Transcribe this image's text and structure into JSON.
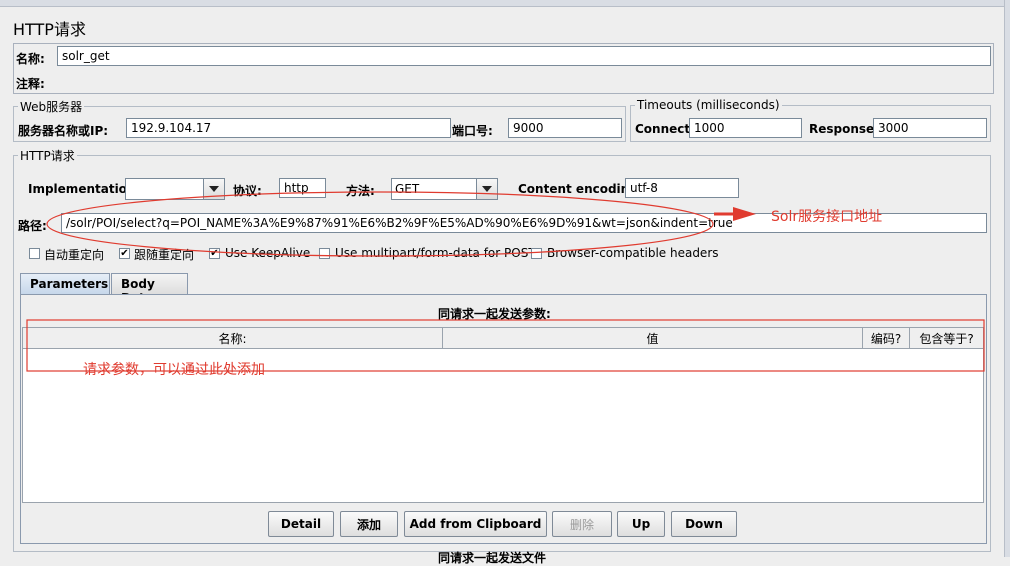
{
  "window": {
    "title": "HTTP请求"
  },
  "basic": {
    "name_label": "名称:",
    "name_value": "solr_get",
    "comment_label": "注释:"
  },
  "web_server": {
    "legend": "Web服务器",
    "server_label": "服务器名称或IP:",
    "server_value": "192.9.104.17",
    "port_label": "端口号:",
    "port_value": "9000"
  },
  "timeouts": {
    "legend": "Timeouts (milliseconds)",
    "connect_label": "Connect:",
    "connect_value": "1000",
    "response_label": "Response:",
    "response_value": "3000"
  },
  "http_request": {
    "legend": "HTTP请求",
    "implementation_label": "Implementation:",
    "implementation_value": "",
    "protocol_label": "协议:",
    "protocol_value": "http",
    "method_label": "方法:",
    "method_value": "GET",
    "encoding_label": "Content encoding:",
    "encoding_value": "utf-8",
    "path_label": "路径:",
    "path_value": "/solr/POI/select?q=POI_NAME%3A%E9%87%91%E6%B2%9F%E5%AD%90%E6%9D%91&wt=json&indent=true"
  },
  "options": [
    {
      "label": "自动重定向",
      "checked": false
    },
    {
      "label": "跟随重定向",
      "checked": true
    },
    {
      "label": "Use KeepAlive",
      "checked": true
    },
    {
      "label": "Use multipart/form-data for POST",
      "checked": false
    },
    {
      "label": "Browser-compatible headers",
      "checked": false
    }
  ],
  "tabs": [
    {
      "label": "Parameters",
      "active": true
    },
    {
      "label": "Body Data",
      "active": false
    }
  ],
  "params": {
    "caption": "同请求一起发送参数:",
    "columns": [
      "名称:",
      "值",
      "编码?",
      "包含等于?"
    ]
  },
  "buttons": {
    "detail": "Detail",
    "add": "添加",
    "add_clipboard": "Add from Clipboard",
    "delete": "删除",
    "up": "Up",
    "down": "Down"
  },
  "bottom_caption": "同请求一起发送文件",
  "annotations": {
    "solr_note": "Solr服务接口地址",
    "param_note": "请求参数，可以通过此处添加",
    "color": "#e03b2f"
  }
}
